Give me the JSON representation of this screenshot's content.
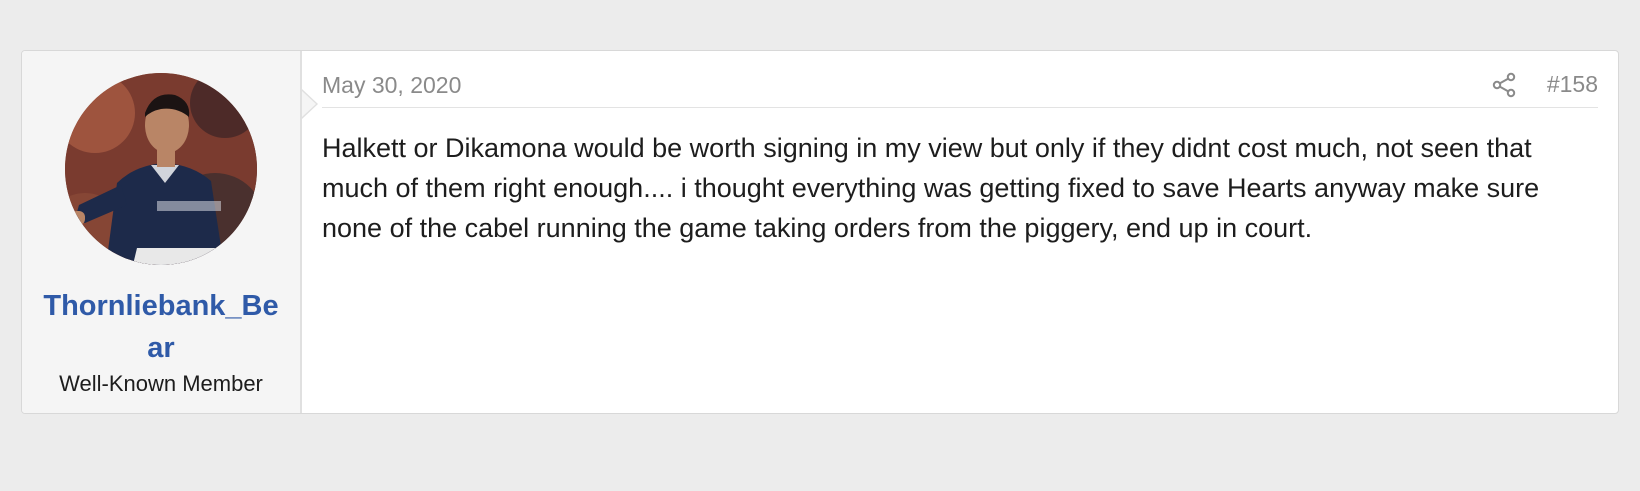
{
  "post": {
    "user": {
      "name": "Thornliebank_Bear",
      "title": "Well-Known Member",
      "avatar_icon": "avatar-photo-icon"
    },
    "date": "May 30, 2020",
    "share_icon": "share-icon",
    "post_number": "#158",
    "body": "Halkett or Dikamona would be worth signing in my view but only if they didnt cost much, not seen that much of them right enough.... i thought everything was getting fixed to save Hearts anyway make sure none of the cabel running the game taking orders from the piggery, end up in court.",
    "colors": {
      "username": "#2f5aa8",
      "meta_text": "#8a8a8a",
      "background": "#ececec"
    }
  }
}
